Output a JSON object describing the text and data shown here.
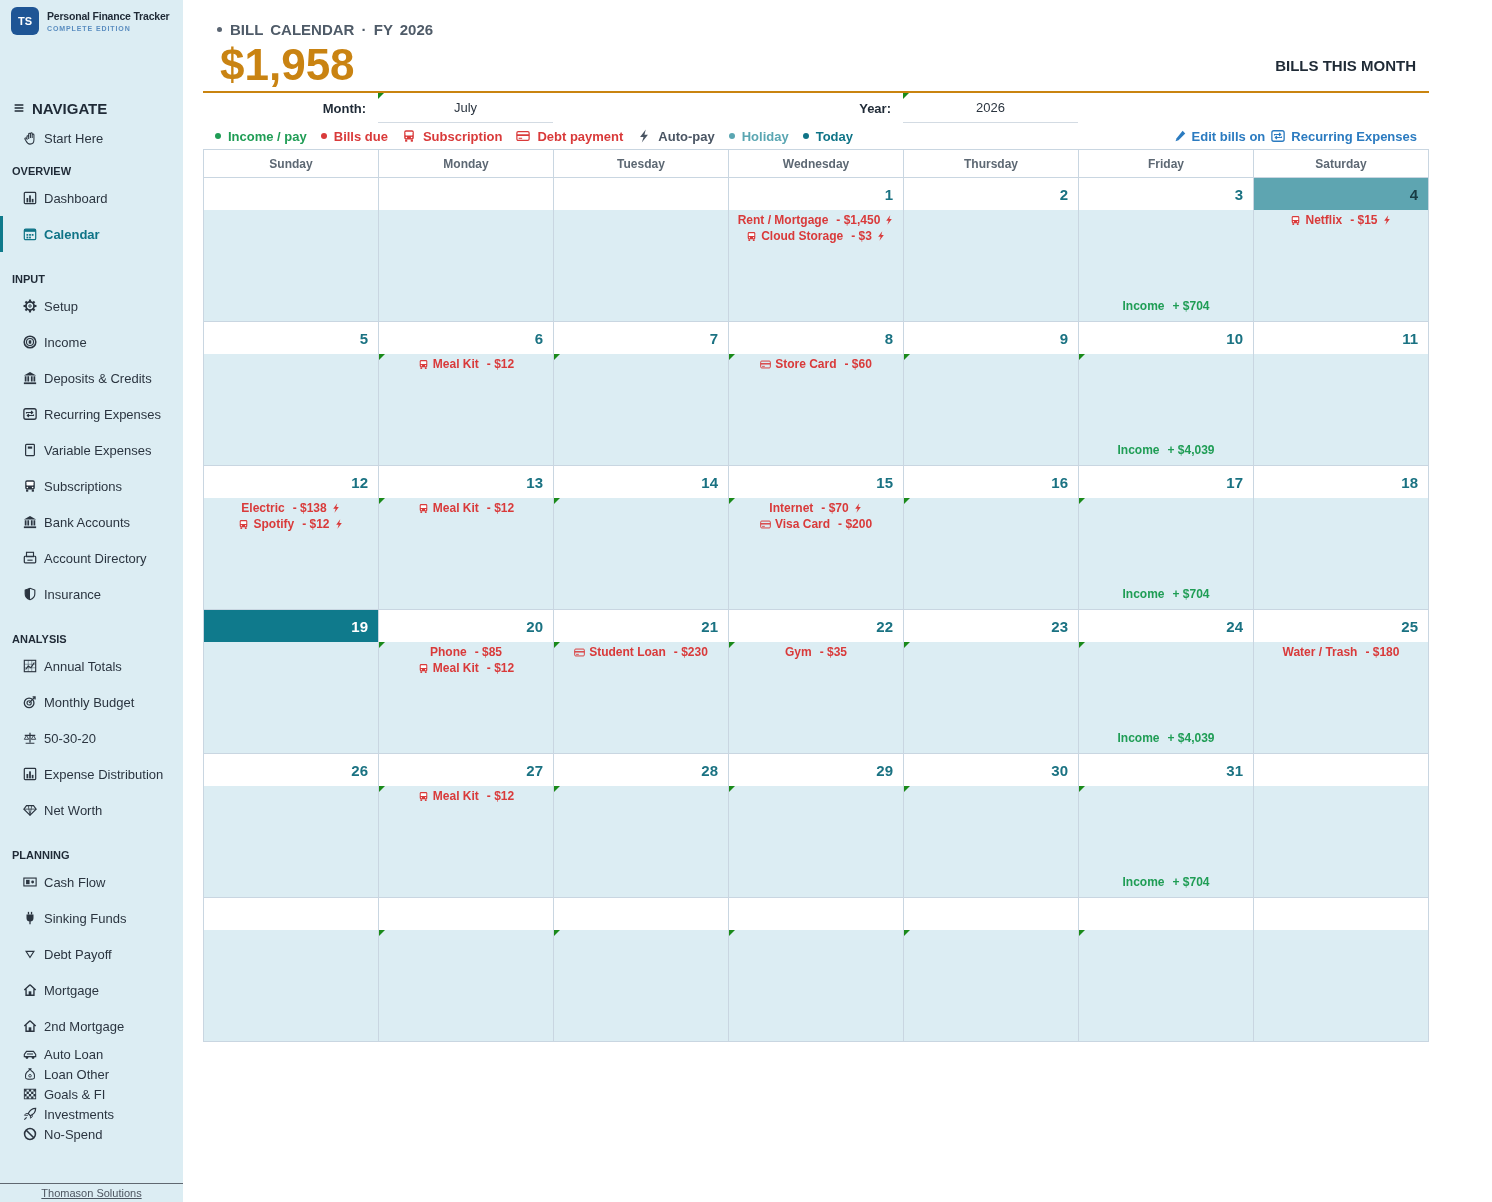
{
  "sidebar": {
    "logo": {
      "initials": "TS",
      "title": "Personal Finance Tracker",
      "subtitle": "COMPLETE EDITION"
    },
    "nav_heading": "NAVIGATE",
    "sections": [
      {
        "items": [
          {
            "label": "Start Here",
            "selected": false
          }
        ]
      },
      {
        "heading": "OVERVIEW",
        "items": [
          {
            "label": "Dashboard",
            "selected": false
          },
          {
            "label": "Calendar",
            "selected": true
          }
        ]
      },
      {
        "heading": "INPUT",
        "items": [
          {
            "label": "Setup",
            "selected": false
          },
          {
            "label": "Income",
            "selected": false
          },
          {
            "label": "Deposits & Credits",
            "selected": false
          },
          {
            "label": "Recurring Expenses",
            "selected": false
          },
          {
            "label": "Variable Expenses",
            "selected": false
          },
          {
            "label": "Subscriptions",
            "selected": false
          },
          {
            "label": "Bank Accounts",
            "selected": false
          },
          {
            "label": "Account Directory",
            "selected": false
          },
          {
            "label": "Insurance",
            "selected": false
          }
        ]
      },
      {
        "heading": "ANALYSIS",
        "items": [
          {
            "label": "Annual Totals",
            "selected": false
          },
          {
            "label": "Monthly Budget",
            "selected": false
          },
          {
            "label": "50-30-20",
            "selected": false
          },
          {
            "label": "Expense Distribution",
            "selected": false
          },
          {
            "label": "Net Worth",
            "selected": false
          }
        ]
      },
      {
        "heading": "PLANNING",
        "items": [
          {
            "label": "Cash Flow",
            "selected": false
          },
          {
            "label": "Sinking Funds",
            "selected": false
          },
          {
            "label": "Debt Payoff",
            "selected": false
          },
          {
            "label": "Mortgage",
            "selected": false
          },
          {
            "label": "2nd Mortgage",
            "selected": false
          },
          {
            "label": "Auto Loan",
            "selected": false
          },
          {
            "label": "Loan Other",
            "selected": false
          },
          {
            "label": "Goals & FI",
            "selected": false
          },
          {
            "label": "Investments",
            "selected": false
          },
          {
            "label": "No-Spend",
            "selected": false
          }
        ]
      }
    ],
    "footer_link": "Thomason Solutions"
  },
  "header": {
    "title": "BILL CALENDAR · FY 2026",
    "total": "$1,958",
    "total_label": "BILLS THIS MONTH"
  },
  "selectors": [
    {
      "label": "Month:",
      "value": "July",
      "flag": true
    },
    {
      "label": "Year:",
      "value": "2026",
      "flag": true
    }
  ],
  "legend": [
    {
      "kind": "dot",
      "label": "Income / pay",
      "color": "#1f9d55"
    },
    {
      "kind": "dot",
      "label": "Bills due",
      "color": "#d93a3a"
    },
    {
      "kind": "subscription",
      "label": "Subscription",
      "color": "#d93a3a"
    },
    {
      "kind": "debt",
      "label": "Debt payment",
      "color": "#d93a3a"
    },
    {
      "kind": "autopay",
      "label": "Auto-pay",
      "color": "#4a5563"
    },
    {
      "kind": "dot",
      "label": "Holiday",
      "color": "#5aa6b2"
    },
    {
      "kind": "dot",
      "label": "Today",
      "color": "#0f7487"
    }
  ],
  "edit_link": {
    "text": "Edit bills on",
    "link": "Recurring Expenses"
  },
  "calendar": {
    "weekdays": [
      "Sunday",
      "Monday",
      "Tuesday",
      "Wednesday",
      "Thursday",
      "Friday",
      "Saturday"
    ],
    "weeks": [
      {
        "days": [
          {
            "holiday": false,
            "today": false,
            "flag": false
          },
          {
            "holiday": false,
            "today": false,
            "flag": false
          },
          {
            "holiday": false,
            "today": false,
            "flag": false
          },
          {
            "day": "1",
            "holiday": false,
            "today": false,
            "flag": false,
            "events": [
              {
                "kind": "bill",
                "label": "Rent / Mortgage",
                "amount": "- $1,450",
                "autopay": true
              },
              {
                "kind": "subscription",
                "label": "Cloud Storage",
                "amount": "- $3",
                "autopay": true
              }
            ]
          },
          {
            "day": "2",
            "holiday": false,
            "today": false,
            "flag": false
          },
          {
            "day": "3",
            "holiday": false,
            "today": false,
            "flag": false,
            "events": [
              {
                "kind": "income",
                "label": "Income",
                "amount": "+ $704",
                "autopay": false
              }
            ]
          },
          {
            "day": "4",
            "holiday": true,
            "today": false,
            "flag": false,
            "events": [
              {
                "kind": "subscription",
                "label": "Netflix",
                "amount": "- $15",
                "autopay": true
              }
            ]
          }
        ]
      },
      {
        "days": [
          {
            "day": "5",
            "holiday": false,
            "today": false,
            "flag": false
          },
          {
            "day": "6",
            "holiday": false,
            "today": false,
            "flag": true,
            "events": [
              {
                "kind": "subscription",
                "label": "Meal Kit",
                "amount": "- $12",
                "autopay": false
              }
            ]
          },
          {
            "day": "7",
            "holiday": false,
            "today": false,
            "flag": true
          },
          {
            "day": "8",
            "holiday": false,
            "today": false,
            "flag": true,
            "events": [
              {
                "kind": "debt",
                "label": "Store Card",
                "amount": "- $60",
                "autopay": false
              }
            ]
          },
          {
            "day": "9",
            "holiday": false,
            "today": false,
            "flag": true
          },
          {
            "day": "10",
            "holiday": false,
            "today": false,
            "flag": true,
            "events": [
              {
                "kind": "income",
                "label": "Income",
                "amount": "+ $4,039",
                "autopay": false
              }
            ]
          },
          {
            "day": "11",
            "holiday": false,
            "today": false,
            "flag": false
          }
        ]
      },
      {
        "days": [
          {
            "day": "12",
            "holiday": false,
            "today": false,
            "flag": false,
            "events": [
              {
                "kind": "bill",
                "label": "Electric",
                "amount": "- $138",
                "autopay": true
              },
              {
                "kind": "subscription",
                "label": "Spotify",
                "amount": "- $12",
                "autopay": true
              }
            ]
          },
          {
            "day": "13",
            "holiday": false,
            "today": false,
            "flag": true,
            "events": [
              {
                "kind": "subscription",
                "label": "Meal Kit",
                "amount": "- $12",
                "autopay": false
              }
            ]
          },
          {
            "day": "14",
            "holiday": false,
            "today": false,
            "flag": true
          },
          {
            "day": "15",
            "holiday": false,
            "today": false,
            "flag": true,
            "events": [
              {
                "kind": "bill",
                "label": "Internet",
                "amount": "- $70",
                "autopay": true
              },
              {
                "kind": "debt",
                "label": "Visa Card",
                "amount": "- $200",
                "autopay": false
              }
            ]
          },
          {
            "day": "16",
            "holiday": false,
            "today": false,
            "flag": true
          },
          {
            "day": "17",
            "holiday": false,
            "today": false,
            "flag": true,
            "events": [
              {
                "kind": "income",
                "label": "Income",
                "amount": "+ $704",
                "autopay": false
              }
            ]
          },
          {
            "day": "18",
            "holiday": false,
            "today": false,
            "flag": false
          }
        ]
      },
      {
        "days": [
          {
            "day": "19",
            "holiday": false,
            "today": true,
            "flag": false
          },
          {
            "day": "20",
            "holiday": false,
            "today": false,
            "flag": true,
            "events": [
              {
                "kind": "bill",
                "label": "Phone",
                "amount": "- $85",
                "autopay": false
              },
              {
                "kind": "subscription",
                "label": "Meal Kit",
                "amount": "- $12",
                "autopay": false
              }
            ]
          },
          {
            "day": "21",
            "holiday": false,
            "today": false,
            "flag": true,
            "events": [
              {
                "kind": "debt",
                "label": "Student Loan",
                "amount": "- $230",
                "autopay": false
              }
            ]
          },
          {
            "day": "22",
            "holiday": false,
            "today": false,
            "flag": true,
            "events": [
              {
                "kind": "bill",
                "label": "Gym",
                "amount": "- $35",
                "autopay": false
              }
            ]
          },
          {
            "day": "23",
            "holiday": false,
            "today": false,
            "flag": true
          },
          {
            "day": "24",
            "holiday": false,
            "today": false,
            "flag": true,
            "events": [
              {
                "kind": "income",
                "label": "Income",
                "amount": "+ $4,039",
                "autopay": false
              }
            ]
          },
          {
            "day": "25",
            "holiday": false,
            "today": false,
            "flag": false,
            "events": [
              {
                "kind": "bill",
                "label": "Water / Trash",
                "amount": "- $180",
                "autopay": false
              }
            ]
          }
        ]
      },
      {
        "days": [
          {
            "day": "26",
            "holiday": false,
            "today": false,
            "flag": false
          },
          {
            "day": "27",
            "holiday": false,
            "today": false,
            "flag": true,
            "events": [
              {
                "kind": "subscription",
                "label": "Meal Kit",
                "amount": "- $12",
                "autopay": false
              }
            ]
          },
          {
            "day": "28",
            "holiday": false,
            "today": false,
            "flag": true
          },
          {
            "day": "29",
            "holiday": false,
            "today": false,
            "flag": true
          },
          {
            "day": "30",
            "holiday": false,
            "today": false,
            "flag": true
          },
          {
            "day": "31",
            "holiday": false,
            "today": false,
            "flag": true,
            "events": [
              {
                "kind": "income",
                "label": "Income",
                "amount": "+ $704",
                "autopay": false
              }
            ]
          },
          {
            "holiday": false,
            "today": false,
            "flag": false
          }
        ]
      },
      {
        "days": [
          {
            "holiday": false,
            "today": false,
            "flag": false
          },
          {
            "holiday": false,
            "today": false,
            "flag": true
          },
          {
            "holiday": false,
            "today": false,
            "flag": true
          },
          {
            "holiday": false,
            "today": false,
            "flag": true
          },
          {
            "holiday": false,
            "today": false,
            "flag": true
          },
          {
            "holiday": false,
            "today": false,
            "flag": true
          },
          {
            "holiday": false,
            "today": false,
            "flag": false
          }
        ]
      }
    ]
  }
}
